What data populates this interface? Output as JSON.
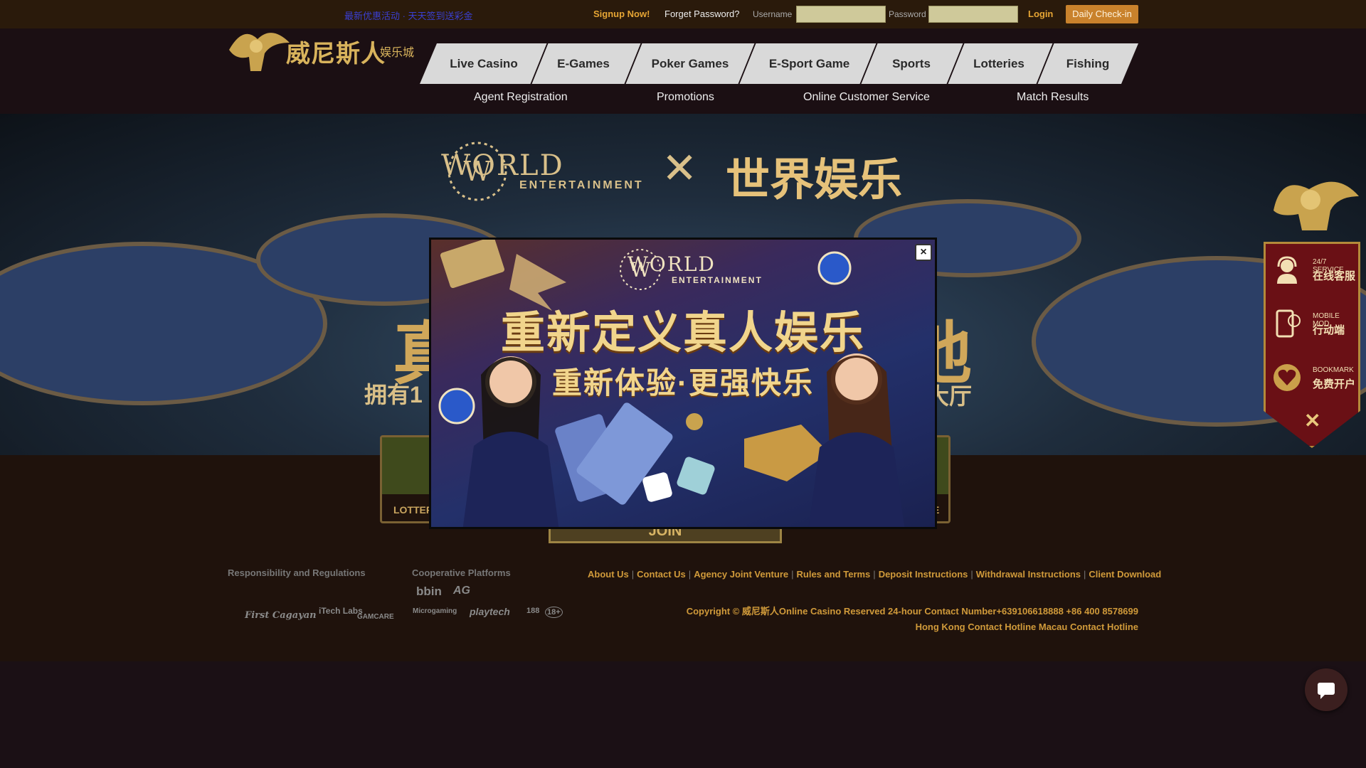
{
  "topbar": {
    "notice": "最新优惠活动 · 天天签到送彩金",
    "signup": "Signup Now!",
    "forget": "Forget Password?",
    "username_label": "Username",
    "password_label": "Password",
    "username_value": "",
    "password_value": "",
    "login": "Login",
    "daily_checkin": "Daily Check-in"
  },
  "logo": {
    "text": "威尼斯人",
    "sub": "娱乐城"
  },
  "nav": {
    "items": [
      "Live Casino",
      "E-Games",
      "Poker Games",
      "E-Sport Game",
      "Sports",
      "Lotteries",
      "Fishing"
    ],
    "sub": [
      "Agent Registration",
      "Promotions",
      "Online Customer Service",
      "Match Results"
    ]
  },
  "banner": {
    "world": "WORLD",
    "entertainment": "ENTERTAINMENT",
    "x": "✕",
    "cn_title": "世界娱乐",
    "big_left": "真",
    "big_right": "地",
    "line3_left": "拥有1",
    "line3_right": "路大厅"
  },
  "side": {
    "service_en": "24/7 SERVICE",
    "service_cn": "在线客服",
    "mobile_en": "MOBILE MOD",
    "mobile_cn": "行动端",
    "bookmark_en": "BOOKMARK",
    "bookmark_cn": "免费开户",
    "close": "✕"
  },
  "cards": {
    "left_label": "LOTTERY",
    "right_label": "E",
    "join": "JOIN"
  },
  "footer": {
    "resp_heading": "Responsibility and Regulations",
    "coop_heading": "Cooperative Platforms",
    "resp_logos": [
      "First Cagayan",
      "iTech Labs",
      "GAMCARE"
    ],
    "coop_logos": [
      "bbin",
      "AG",
      "Microgaming",
      "playtech",
      "188",
      "18+"
    ],
    "links": [
      "About Us",
      "Contact Us",
      "Agency Joint Venture",
      "Rules and Terms",
      "Deposit Instructions",
      "Withdrawal Instructions",
      "Client Download"
    ],
    "copyright": "Copyright © 威尼斯人Online Casino Reserved 24-hour Contact Number+639106618888 +86 400 8578699",
    "hotline": "Hong Kong Contact Hotline Macau Contact Hotline"
  },
  "popup": {
    "world": "WORLD",
    "entertainment": "ENTERTAINMENT",
    "title": "重新定义真人娱乐",
    "subtitle": "重新体验·更强快乐",
    "close": "×"
  },
  "colors": {
    "accent": "#e6a534",
    "gold": "#d9c08a",
    "nav_bg": "#d9d9d9",
    "side_bg": "#6a1015"
  }
}
